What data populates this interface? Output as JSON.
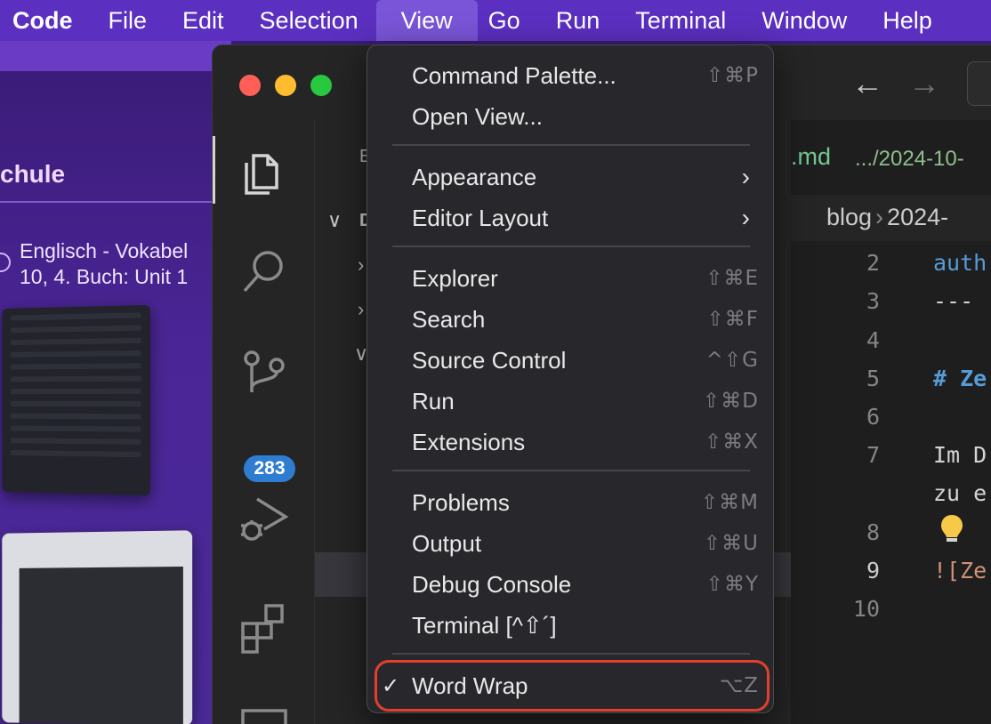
{
  "menubar": {
    "app": "Code",
    "items": [
      "File",
      "Edit",
      "Selection",
      "View",
      "Go",
      "Run",
      "Terminal",
      "Window",
      "Help"
    ],
    "active": "View"
  },
  "background": {
    "heading": "chule",
    "caption_line1": "Englisch - Vokabel",
    "caption_line2": "10, 4. Buch: Unit 1"
  },
  "vscode": {
    "activity": {
      "scm_badge": "283"
    },
    "sidebar": {
      "title": "E",
      "row_letter": "D"
    },
    "tab": {
      "name": ".md",
      "path": ".../2024-10-"
    },
    "breadcrumb": {
      "part1": "blog",
      "part2": "2024-"
    },
    "gutter": [
      "2",
      "3",
      "4",
      "5",
      "6",
      "7",
      "8",
      "9",
      "10"
    ],
    "code": {
      "line2": "auth",
      "line3": "---",
      "line5": "# Ze",
      "line7a": "Im D",
      "line7b": "zu e",
      "line9": "![Ze"
    }
  },
  "view_menu": {
    "sections": [
      [
        {
          "label": "Command Palette...",
          "shortcut": "⇧⌘P"
        },
        {
          "label": "Open View...",
          "shortcut": ""
        }
      ],
      [
        {
          "label": "Appearance",
          "submenu": true
        },
        {
          "label": "Editor Layout",
          "submenu": true
        }
      ],
      [
        {
          "label": "Explorer",
          "shortcut": "⇧⌘E"
        },
        {
          "label": "Search",
          "shortcut": "⇧⌘F"
        },
        {
          "label": "Source Control",
          "shortcut": "^⇧G"
        },
        {
          "label": "Run",
          "shortcut": "⇧⌘D"
        },
        {
          "label": "Extensions",
          "shortcut": "⇧⌘X"
        }
      ],
      [
        {
          "label": "Problems",
          "shortcut": "⇧⌘M"
        },
        {
          "label": "Output",
          "shortcut": "⇧⌘U"
        },
        {
          "label": "Debug Console",
          "shortcut": "⇧⌘Y"
        },
        {
          "label": "Terminal [^⇧´]",
          "shortcut": ""
        }
      ],
      [
        {
          "label": "Word Wrap",
          "shortcut": "⌥Z",
          "checked": true
        }
      ]
    ],
    "checkmark": "✓",
    "highlight_color": "#e2402c"
  },
  "colors": {
    "menubar": "#5b2fc0",
    "badge": "#2f7dd1"
  }
}
